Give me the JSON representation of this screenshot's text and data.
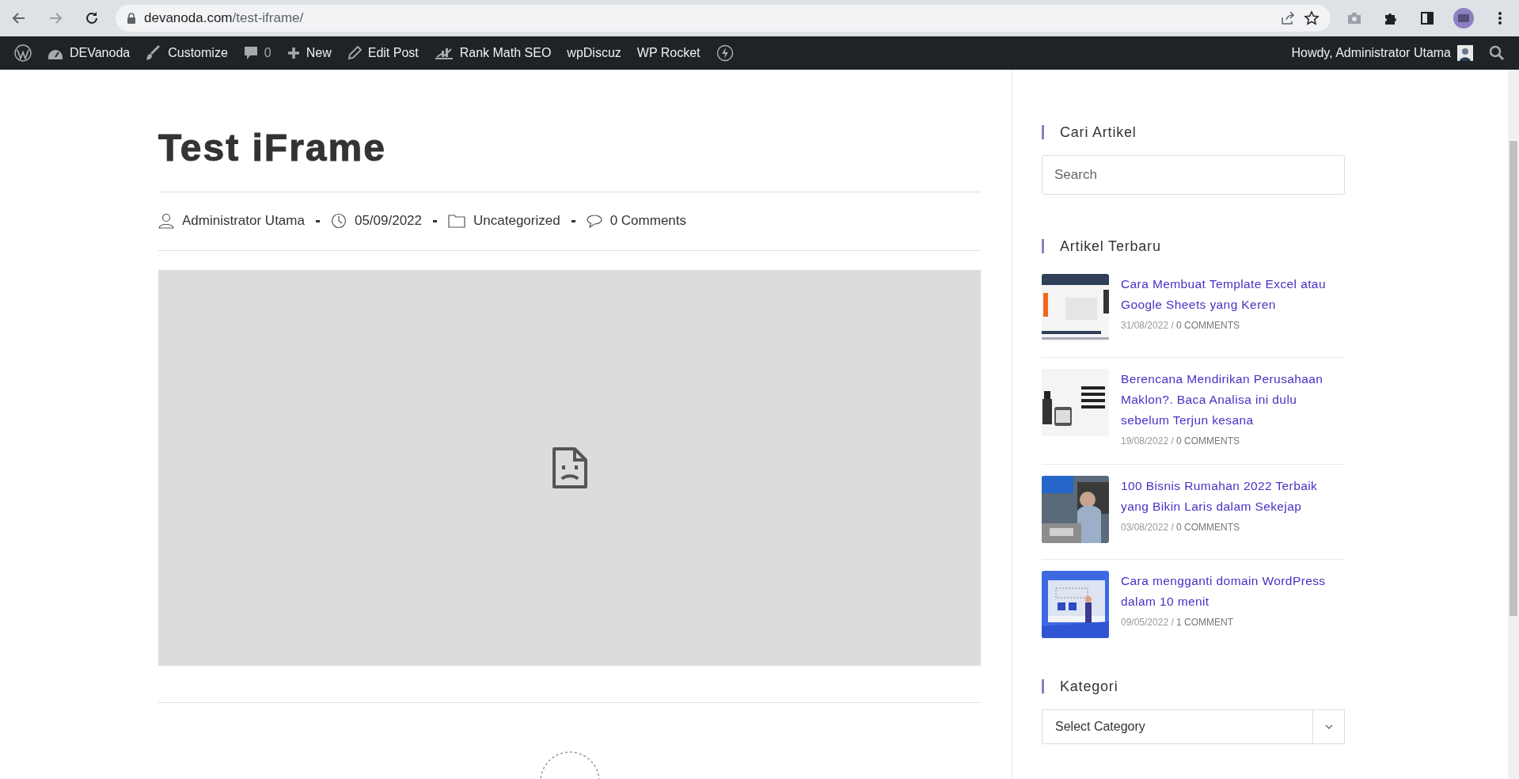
{
  "browser": {
    "url_host": "devanoda.com",
    "url_path": "/test-iframe/"
  },
  "admin_bar": {
    "items": [
      {
        "kind": "wp"
      },
      {
        "kind": "dashboard",
        "label": "DEVanoda"
      },
      {
        "kind": "brush",
        "label": "Customize"
      },
      {
        "kind": "comment",
        "label": "0"
      },
      {
        "kind": "plus",
        "label": "New"
      },
      {
        "kind": "pencil",
        "label": "Edit Post"
      },
      {
        "kind": "chart",
        "label": "Rank Math SEO"
      },
      {
        "kind": "text",
        "label": "wpDiscuz"
      },
      {
        "kind": "text",
        "label": "WP Rocket"
      },
      {
        "kind": "bolt"
      }
    ],
    "greeting": "Howdy, Administrator Utama"
  },
  "post": {
    "title": "Test iFrame",
    "meta": [
      {
        "kind": "author",
        "text": "Administrator Utama"
      },
      {
        "kind": "date",
        "text": "05/09/2022"
      },
      {
        "kind": "category",
        "text": "Uncategorized"
      },
      {
        "kind": "comments",
        "text": "0 Comments"
      }
    ]
  },
  "sidebar": {
    "search": {
      "title": "Cari Artikel",
      "placeholder": "Search"
    },
    "recent": {
      "title": "Artikel Terbaru",
      "posts": [
        {
          "title": "Cara Membuat Template Excel atau Google Sheets yang Keren",
          "date": "31/08/2022 /",
          "comments": "0 COMMENTS",
          "kind": "picture"
        },
        {
          "title": "Berencana Mendirikan Perusahaan Maklon?. Baca Analisa ini dulu sebelum Terjun kesana",
          "date": "19/08/2022 /",
          "comments": "0 COMMENTS",
          "kind": "picture"
        },
        {
          "title": "100 Bisnis Rumahan 2022 Terbaik yang Bikin Laris dalam Sekejap",
          "date": "03/08/2022 /",
          "comments": "0 COMMENTS",
          "kind": "picture"
        },
        {
          "title": "Cara mengganti domain WordPress dalam 10 menit",
          "date": "09/05/2022 /",
          "comments": "1 COMMENT",
          "kind": "picture"
        }
      ]
    },
    "categories": {
      "title": "Kategori",
      "value": "Select Category"
    }
  }
}
